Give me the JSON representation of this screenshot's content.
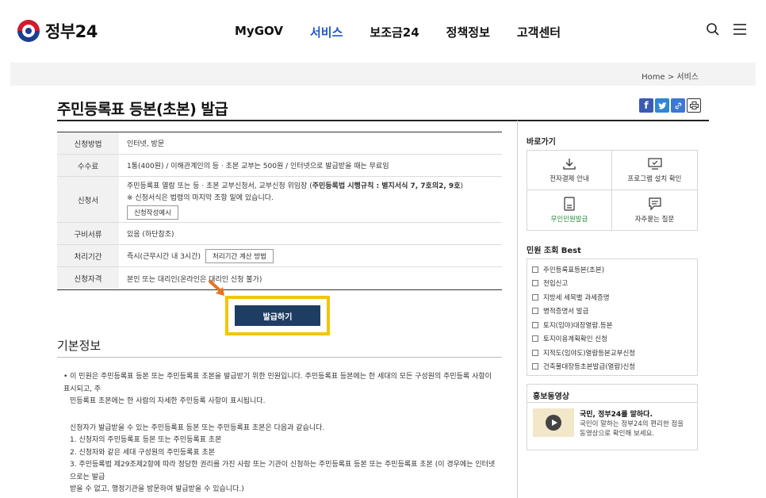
{
  "header": {
    "logo_text": "정부24",
    "nav": [
      "MyGOV",
      "서비스",
      "보조금24",
      "정책정보",
      "고객센터"
    ],
    "active_nav": "서비스"
  },
  "breadcrumb": "Home  >  서비스",
  "page_title": "주민등록표 등본(초본) 발급",
  "table": {
    "method": {
      "label": "신청방법",
      "value": "인터넷, 방문"
    },
    "fee": {
      "label": "수수료",
      "value": "1통(400원) / 이해관계인의 등 · 초본 교부는 500원 / 인터넷으로 발급받을 때는 무료임"
    },
    "form": {
      "label": "신청서",
      "line1_plain": "주민등록표 열람 또는 등 · 초본 교부신청서, 교부신청 위임장 (",
      "line1_bold": "주민등록법 시행규칙 : 별지서식 7, 7호의2, 9호",
      "line1_end": ")",
      "line2": "※ 신청서식은 법령의 마지막 조항 밑에 있습니다.",
      "example_btn": "신청작성예시"
    },
    "docs": {
      "label": "구비서류",
      "value": "있음 (하단참조)"
    },
    "period": {
      "label": "처리기간",
      "value": "즉시(근무시간 내 3시간)",
      "btn": "처리기간 계산 방법"
    },
    "eligibility": {
      "label": "신청자격",
      "value": "본인 또는 대리인(온라인은 대리인 신청 불가)"
    }
  },
  "issue_button": "발급하기",
  "basic": {
    "title": "기본정보",
    "lines": [
      "•  이 민원은 주민등록표 등본 또는 주민등록표 초본을 발급받기 위한 민원입니다. 주민등록표 등본에는 한 세대의 모든 구성원의 주민등록 사항이 표시되고, 주",
      "민등록표 초본에는 한 사람의 자세한 주민등록 사항이 표시됩니다.",
      "",
      "신청자가 발급받을 수 있는 주민등록표 등본 또는 주민등록표 초본은 다음과 같습니다.",
      "1. 신청자의 주민등록표 등본 또는 주민등록표 초본",
      "2. 신청자와 같은 세대 구성원의 주민등록표 초본",
      "3. 주민등록법 제29조제2항에 따라 정당한 권리를 가진 사람 또는 기관이 신청하는 주민등록표 등본 또는 주민등록표 초본 (이 경우에는 인터넷으로는 발급",
      "받을 수 없고, 행정기관을 방문하여 발급받을 수 있습니다.)"
    ]
  },
  "side": {
    "quick_title": "바로가기",
    "quick": [
      "전자결제 안내",
      "프로그램 설치 확인",
      "무인민원발급",
      "자주묻는 질문"
    ],
    "best_title": "민원 조회 Best",
    "best": [
      "주민등록표등본(초본)",
      "전입신고",
      "지방세 세목별 과세증명",
      "병적증명서 발급",
      "토지(임야)대장열람.등본",
      "토지이용계획확인 신청",
      "지적도(임야도)열람등본교부신청",
      "건축물대장등초본발급(열람)신청"
    ],
    "promo_title": "홍보동영상",
    "promo_video_title": "국민, 정부24를 말하다.",
    "promo_desc": "국민이 말하는 정부24의 편리한 점을 동영상으로 확인해 보세요."
  },
  "colors": {
    "active_nav": "#2159c9",
    "issue_btn": "#1e3d63",
    "highlight": "#f5c40a",
    "arrow": "#e8731e"
  }
}
